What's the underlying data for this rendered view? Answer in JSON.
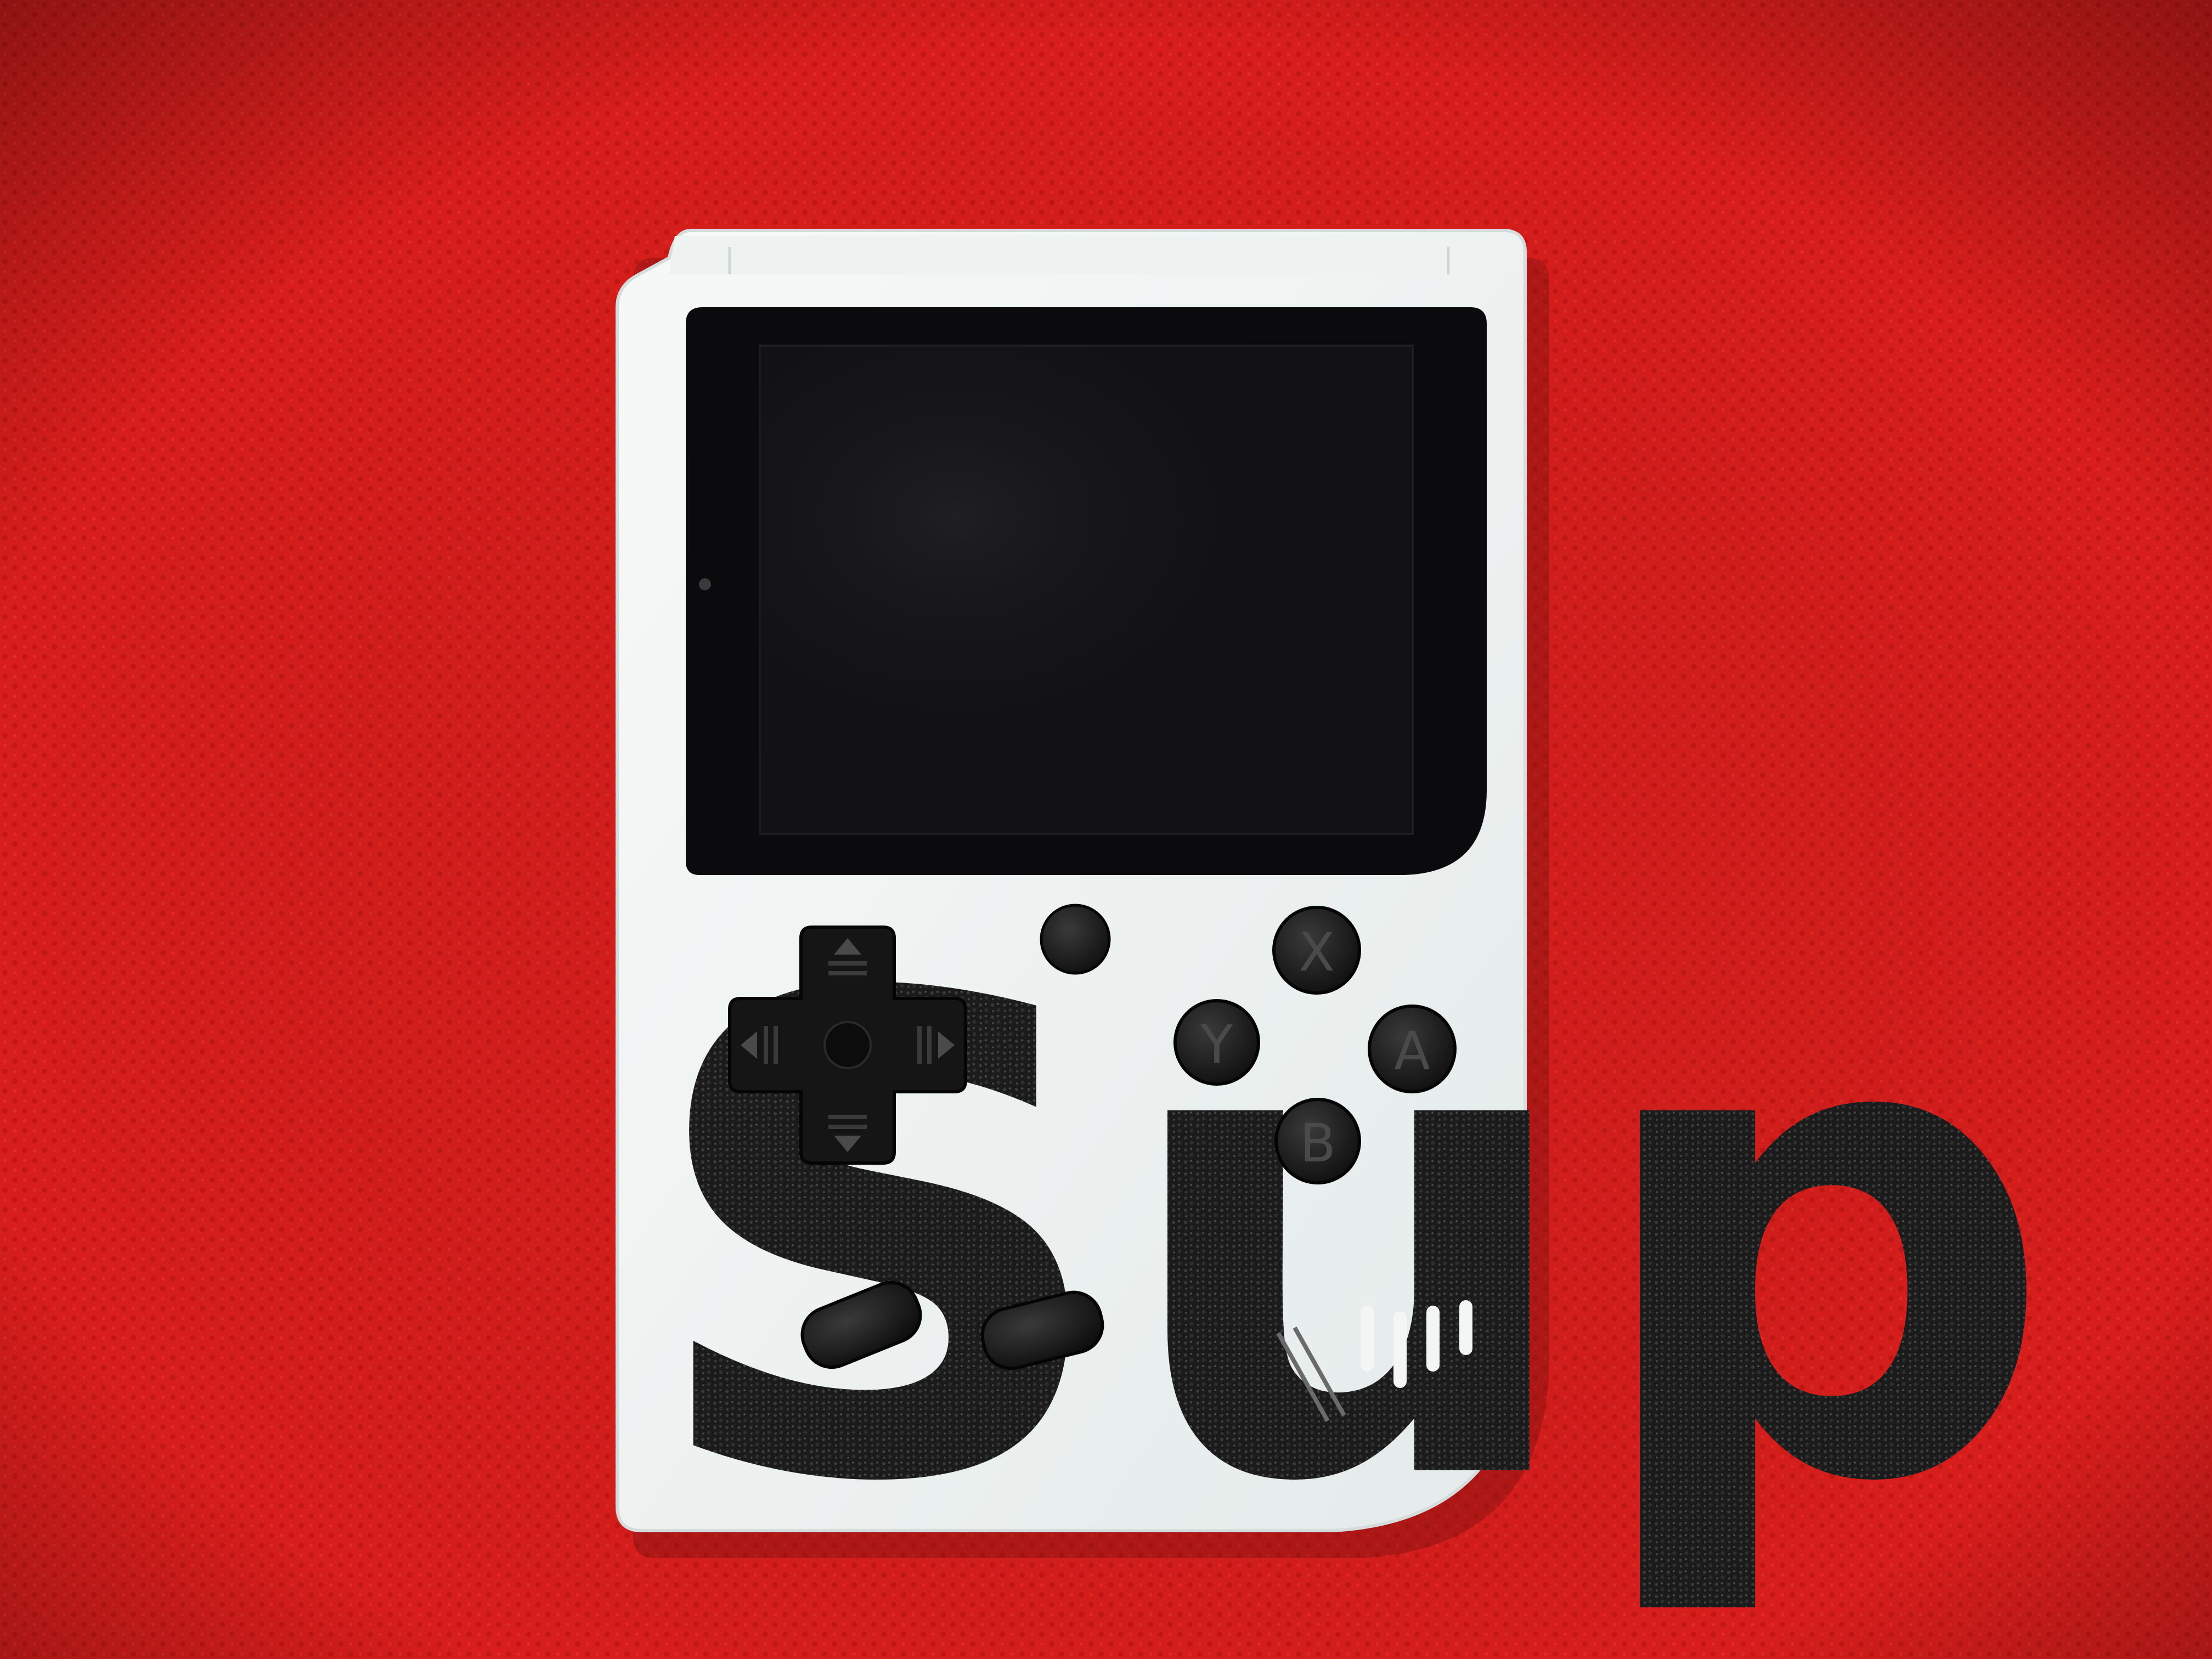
{
  "colors": {
    "background": "#d81e1c",
    "shell": "#f3f6f5",
    "screen": "#0b0b0d",
    "logo": "#1b1b1b",
    "buttons": "#161616"
  },
  "logo": {
    "text": "Sup"
  },
  "face_buttons": {
    "x": "X",
    "y": "Y",
    "a": "A",
    "b": "B"
  },
  "icons": {
    "dpad": "dpad-cross-icon",
    "arrow_up": "triangle-up-icon",
    "arrow_down": "triangle-down-icon",
    "arrow_left": "triangle-left-icon",
    "arrow_right": "triangle-right-icon"
  }
}
